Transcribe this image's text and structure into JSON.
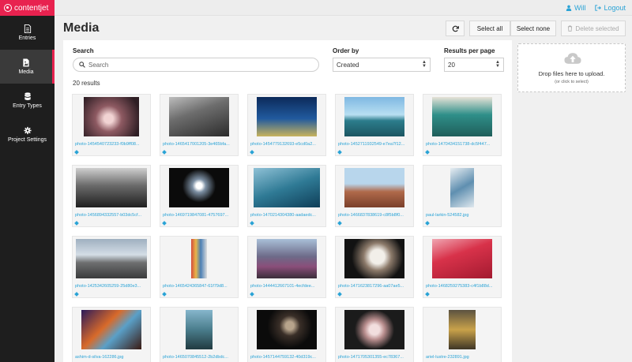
{
  "app": {
    "logo_text": "contentjet",
    "brand_color": "#e8224f",
    "link_color": "#2aa3d6"
  },
  "topbar": {
    "user_label": "Will",
    "user_icon": "user-icon",
    "logout_label": "Logout",
    "logout_icon": "logout-icon"
  },
  "sidebar": {
    "items": [
      {
        "label": "Entries",
        "icon": "file-icon",
        "active": false
      },
      {
        "label": "Media",
        "icon": "image-icon",
        "active": true
      },
      {
        "label": "Entry Types",
        "icon": "database-icon",
        "active": false
      },
      {
        "label": "Project Settings",
        "icon": "gear-icon",
        "active": false
      }
    ]
  },
  "header": {
    "title": "Media",
    "refresh_icon": "refresh-icon",
    "select_all_label": "Select all",
    "select_none_label": "Select none",
    "delete_label": "Delete selected",
    "delete_icon": "trash-icon"
  },
  "filters": {
    "search_label": "Search",
    "search_placeholder": "Search",
    "order_by_label": "Order by",
    "order_by_value": "Created",
    "results_per_page_label": "Results per page",
    "results_per_page_value": "20"
  },
  "results_count": "20 results",
  "upload": {
    "text": "Drop files here to upload.",
    "subtext": "(or click to select)",
    "icon": "cloud-upload-icon"
  },
  "media": [
    {
      "filename": "photo-1454540723233-f0b9ff08..."
    },
    {
      "filename": "photo-1465417001205-3e465bfa..."
    },
    {
      "filename": "photo-1454779132693-e5cd0a2..."
    },
    {
      "filename": "photo-1452711932549-e7ea7f12..."
    },
    {
      "filename": "photo-1470434151738-dc5f447..."
    },
    {
      "filename": "photo-1456894332557-b03dc5cf..."
    },
    {
      "filename": "photo-1469719847081-4757697..."
    },
    {
      "filename": "photo-1470214304380-aadaedc..."
    },
    {
      "filename": "photo-1466837838619-c8f5b8f0..."
    },
    {
      "filename": "paul-larkin-524582.jpg"
    },
    {
      "filename": "photo-1425342605259-25d80e3..."
    },
    {
      "filename": "photo-1465424365847-61f79d8..."
    },
    {
      "filename": "photo-1444412667101-4ecfdee..."
    },
    {
      "filename": "photo-1471623817296-aa07ae5..."
    },
    {
      "filename": "photo-1468259275383-c4f1b88d..."
    },
    {
      "filename": "ashim-d-silva-162286.jpg"
    },
    {
      "filename": "photo-1465070845512-2b2dbdc..."
    },
    {
      "filename": "photo-1457144759132-40d319c..."
    },
    {
      "filename": "photo-1471705301355-ec78367..."
    },
    {
      "filename": "ariel-lustre-232891.jpg"
    }
  ]
}
